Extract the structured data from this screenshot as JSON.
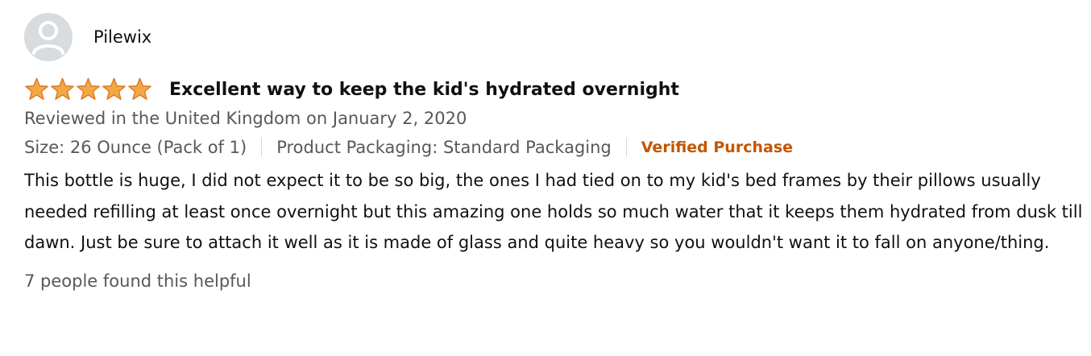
{
  "profile": {
    "name": "Pilewix",
    "avatar_icon": "default-user-avatar-icon"
  },
  "rating": {
    "stars": 5,
    "max": 5,
    "star_color": "#f3a847"
  },
  "review": {
    "title": "Excellent way to keep the kid's hydrated overnight",
    "date_line": "Reviewed in the United Kingdom on January 2, 2020",
    "size": "Size: 26 Ounce (Pack of 1)",
    "packaging": "Product Packaging: Standard Packaging",
    "verified": "Verified Purchase",
    "body": "This bottle is huge, I did not expect it to be so big, the ones I had tied on to my kid's bed frames by their pillows usually needed refilling at least once overnight but this amazing one holds so much water that it keeps them hydrated from dusk till dawn. Just be sure to attach it well as it is made of glass and quite heavy so you wouldn't want it to fall on anyone/thing."
  },
  "helpful": {
    "text": "7 people found this helpful"
  },
  "colors": {
    "verified": "#c45500",
    "secondary_text": "#565959",
    "avatar_bg": "#d8dcdf"
  }
}
